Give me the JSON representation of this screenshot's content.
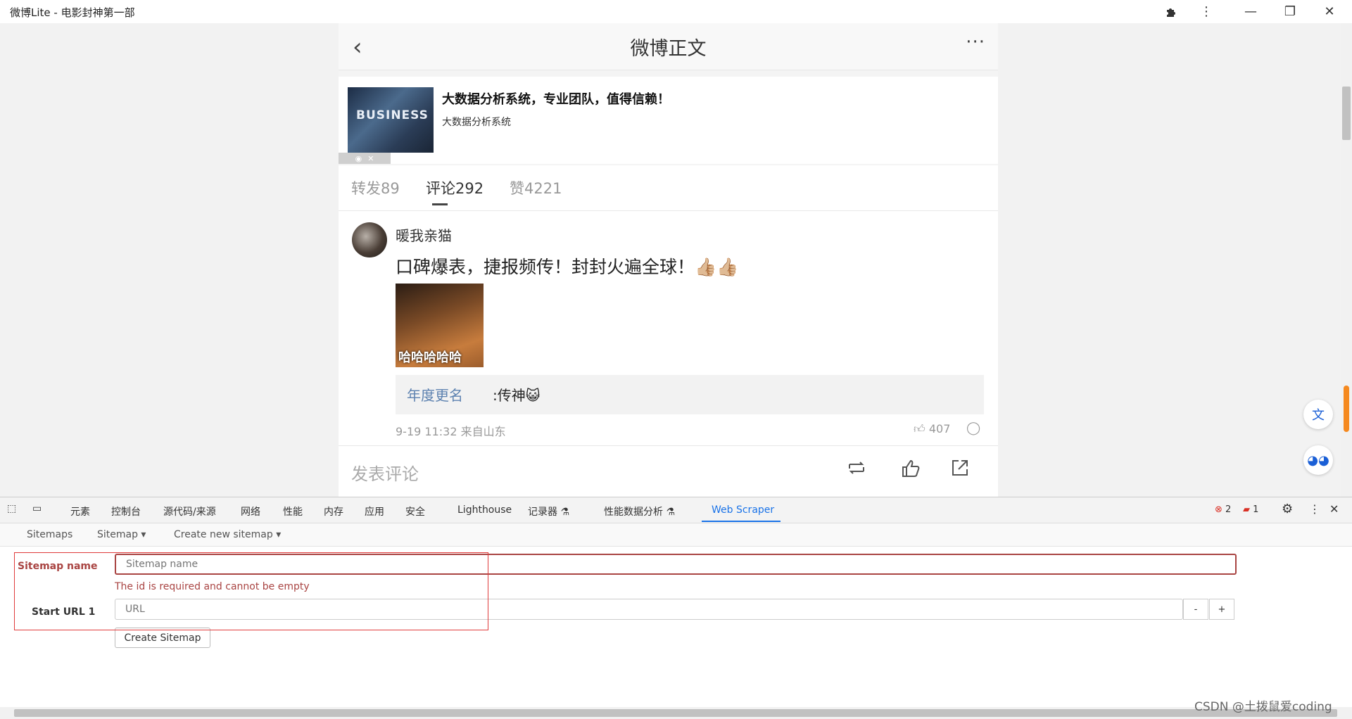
{
  "window": {
    "title": "微博Lite - 电影封神第一部",
    "controls": [
      "extension-icon",
      "menu-icon",
      "minimize-icon",
      "restore-icon",
      "close-icon"
    ]
  },
  "page": {
    "nav": {
      "back": "‹",
      "title": "微博正文",
      "more": "···"
    },
    "ad": {
      "thumb_text": "BUSINESS",
      "headline": "大数据分析系统，专业团队，值得信赖！",
      "subtitle": "大数据分析系统"
    },
    "tabs": [
      {
        "label": "转发89",
        "active": false
      },
      {
        "label": "评论292",
        "active": true
      },
      {
        "label": "赞4221",
        "active": false
      }
    ],
    "comment": {
      "username": "暖我亲猫",
      "text": "口碑爆表，捷报频传！封封火遍全球！👍🏼👍🏼",
      "gif_caption": "哈哈哈哈哈",
      "reply_user": "年度更名",
      "reply_text": ":传神😺",
      "meta": "9-19 11:32 来自山东",
      "likes": "407"
    },
    "bottom": {
      "placeholder": "发表评论"
    }
  },
  "devtools": {
    "tabs": [
      "元素",
      "控制台",
      "源代码/来源",
      "网络",
      "性能",
      "内存",
      "应用",
      "安全",
      "Lighthouse",
      "记录器 ⚗",
      "性能数据分析 ⚗",
      "Web Scraper"
    ],
    "active_tab": "Web Scraper",
    "errors": "2",
    "issues": "1",
    "scraper_nav": {
      "sitemaps": "Sitemaps",
      "sitemap": "Sitemap ▾",
      "create": "Create new sitemap ▾"
    },
    "form": {
      "name_label": "Sitemap name",
      "name_placeholder": "Sitemap name",
      "error": "The id is required and cannot be empty",
      "url_label": "Start URL 1",
      "url_placeholder": "URL",
      "minus": "-",
      "plus": "+",
      "submit": "Create Sitemap"
    }
  },
  "watermark": "CSDN @土拨鼠爱coding",
  "colors": {
    "accent": "#1a73e8",
    "error": "#a94442",
    "orange": "#f5891f",
    "link": "#5d82b0"
  }
}
